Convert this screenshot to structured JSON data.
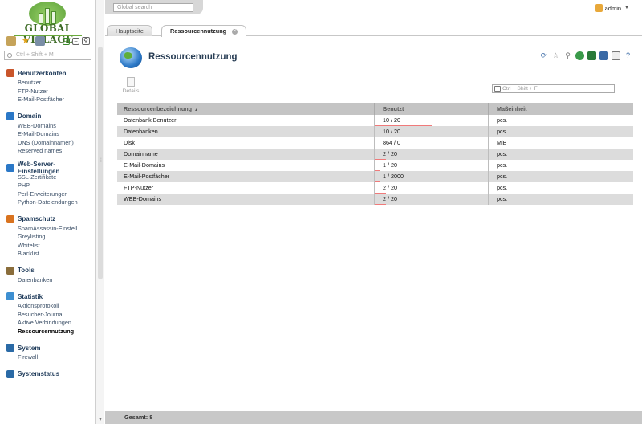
{
  "logo": {
    "text": "GLOBAL VILLAGE"
  },
  "side_search": {
    "placeholder": "Ctrl + Shift + M"
  },
  "global_search": {
    "placeholder": "Global search"
  },
  "user": {
    "name": "admin"
  },
  "tabs": [
    {
      "label": "Hauptseite",
      "active": false
    },
    {
      "label": "Ressourcennutzung",
      "active": true
    }
  ],
  "menu": [
    {
      "title": "Benutzerkonten",
      "icon": "users-icon",
      "color": "#c9552b",
      "items": [
        "Benutzer",
        "FTP-Nutzer",
        "E-Mail-Postfächer"
      ]
    },
    {
      "title": "Domain",
      "icon": "globe-icon",
      "color": "#2b78c7",
      "items": [
        "WEB-Domains",
        "E-Mail-Domains",
        "DNS (Domainnamen)",
        "Reserved names"
      ]
    },
    {
      "title": "Web-Server-Einstellungen",
      "icon": "web-globe-icon",
      "color": "#2b78c7",
      "items": [
        "SSL-Zertifikate",
        "PHP",
        "Perl-Erweiterungen",
        "Python-Dateiendungen"
      ]
    },
    {
      "title": "Spamschutz",
      "icon": "spam-shield-icon",
      "color": "#d9731f",
      "items": [
        "SpamAssassin-Einstell...",
        "Greylisting",
        "Whitelist",
        "Blacklist"
      ]
    },
    {
      "title": "Tools",
      "icon": "tools-icon",
      "color": "#8a6d3b",
      "items": [
        "Datenbanken"
      ]
    },
    {
      "title": "Statistik",
      "icon": "statistics-icon",
      "color": "#3d8fd1",
      "items": [
        "Aktionsprotokoll",
        "Besucher-Journal",
        "Aktive Verbindungen",
        "Ressourcennutzung"
      ],
      "active_index": 3
    },
    {
      "title": "System",
      "icon": "system-icon",
      "color": "#2a6aa6",
      "items": [
        "Firewall"
      ]
    },
    {
      "title": "Systemstatus",
      "icon": "system-status-icon",
      "color": "#2a6aa6",
      "items": []
    }
  ],
  "page": {
    "title": "Ressourcennutzung",
    "details_label": "Details",
    "filter_placeholder": "Ctrl + Shift + F"
  },
  "table": {
    "columns": [
      "Ressourcenbezeichnung",
      "Benutzt",
      "Maßeinheit"
    ],
    "rows": [
      {
        "name": "Datenbank Benutzer",
        "used": "10 / 20",
        "unit": "pcs.",
        "usage": 0.5
      },
      {
        "name": "Datenbanken",
        "used": "10 / 20",
        "unit": "pcs.",
        "usage": 0.5
      },
      {
        "name": "Disk",
        "used": "864 / 0",
        "unit": "MiB",
        "usage": 0
      },
      {
        "name": "Domainname",
        "used": "2 / 20",
        "unit": "pcs.",
        "usage": 0.1
      },
      {
        "name": "E-Mail-Domains",
        "used": "1 / 20",
        "unit": "pcs.",
        "usage": 0.05
      },
      {
        "name": "E-Mail-Postfächer",
        "used": "1 / 2000",
        "unit": "pcs.",
        "usage": 0.0005
      },
      {
        "name": "FTP-Nutzer",
        "used": "2 / 20",
        "unit": "pcs.",
        "usage": 0.1
      },
      {
        "name": "WEB-Domains",
        "used": "2 / 20",
        "unit": "pcs.",
        "usage": 0.1
      }
    ]
  },
  "footer": {
    "total_label": "Gesamt: 8"
  }
}
